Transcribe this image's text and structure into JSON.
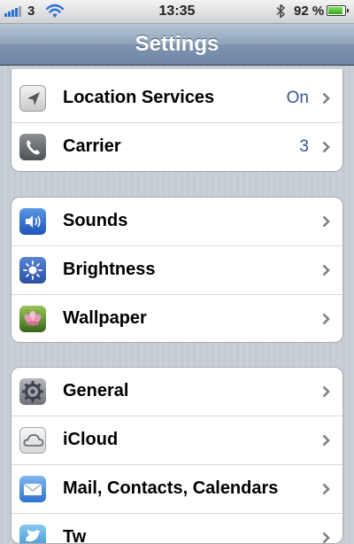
{
  "status_bar": {
    "carrier": "3",
    "time": "13:35",
    "battery": "92 %",
    "battery_level": 0.92,
    "icons": [
      "signal-icon",
      "wifi-icon",
      "bluetooth-icon",
      "battery-icon"
    ]
  },
  "nav": {
    "title": "Settings"
  },
  "group1": {
    "rows": [
      {
        "label": "Location Services",
        "value": "On",
        "icon": "location-arrow-icon"
      },
      {
        "label": "Carrier",
        "value": "3",
        "icon": "phone-icon"
      }
    ]
  },
  "group2": {
    "rows": [
      {
        "label": "Sounds",
        "icon": "speaker-icon"
      },
      {
        "label": "Brightness",
        "icon": "sun-icon"
      },
      {
        "label": "Wallpaper",
        "icon": "flower-icon"
      }
    ]
  },
  "group3": {
    "rows": [
      {
        "label": "General",
        "icon": "gear-icon"
      },
      {
        "label": "iCloud",
        "icon": "cloud-icon"
      },
      {
        "label": "Mail, Contacts, Calendars",
        "icon": "envelope-icon"
      },
      {
        "label": "Tw",
        "icon": "twitter-bird-icon"
      }
    ]
  },
  "colors": {
    "value_text": "#385487",
    "nav_bar": "#7d93b0",
    "background": "#c5ccd4"
  }
}
